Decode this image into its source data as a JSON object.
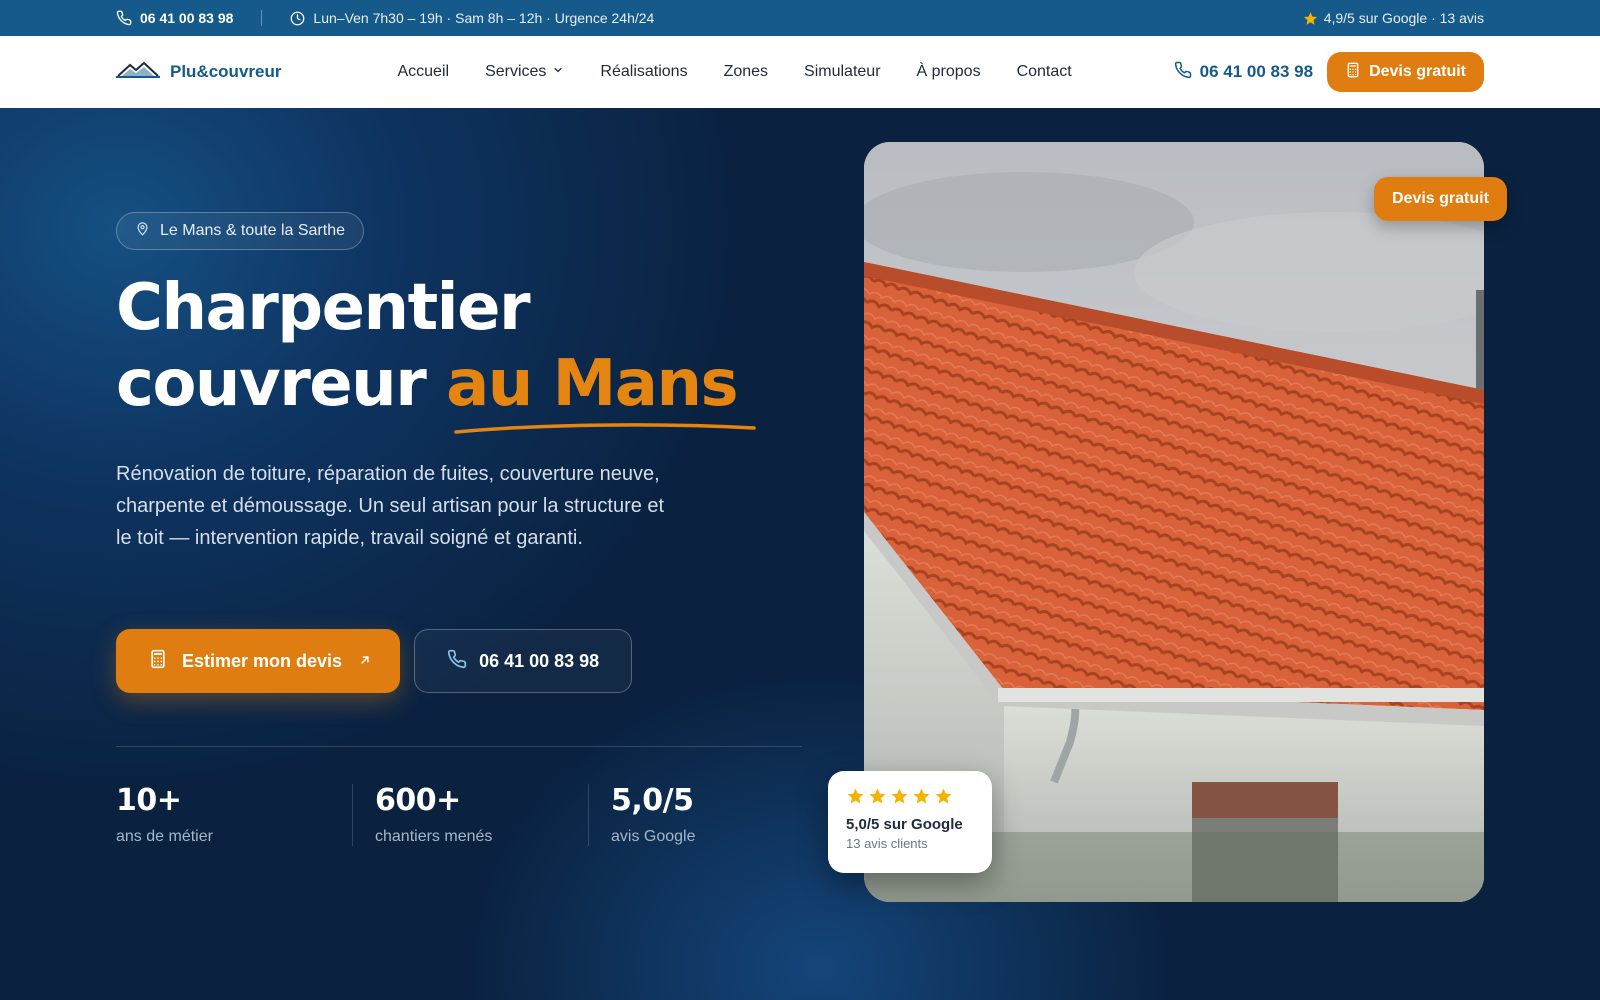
{
  "colors": {
    "accent": "#e07d10",
    "brand": "#155a8a",
    "hero_bg": "#0a2240",
    "star": "#f5b301"
  },
  "topbar": {
    "phone": "06 41 00 83 98",
    "hours": "Lun–Ven 7h30 – 19h · Sam 8h – 12h · Urgence 24h/24",
    "rating": "4,9/5 sur Google · 13 avis"
  },
  "nav": {
    "logo": "Plu&couvreur",
    "items": [
      "Accueil",
      "Services",
      "Réalisations",
      "Zones",
      "Simulateur",
      "À propos",
      "Contact"
    ],
    "phone": "06 41 00 83 98",
    "cta": "Devis gratuit"
  },
  "hero": {
    "location": "Le Mans & toute la Sarthe",
    "title_line1": "Charpentier",
    "title_line2_start": "couvreur ",
    "title_accent": "au Mans",
    "lead": "Rénovation de toiture, réparation de fuites, couverture neuve, charpente et démoussage. Un seul artisan pour la structure et le toit — intervention rapide, travail soigné et garanti.",
    "cta_primary": "Estimer mon devis",
    "cta_phone": "06 41 00 83 98",
    "stats": [
      {
        "value": "10+",
        "label": "ans de métier"
      },
      {
        "value": "600+",
        "label": "chantiers menés"
      },
      {
        "value": "5,0/5",
        "label": "avis Google"
      }
    ],
    "photo_badge": "Devis gratuit",
    "review": {
      "stars": 5,
      "title": "5,0/5 sur Google",
      "subtitle": "13 avis clients"
    }
  },
  "icons": [
    "phone-icon",
    "clock-icon",
    "star-icon",
    "chevron-down-icon",
    "calculator-icon",
    "map-pin-icon",
    "arrow-up-right-icon"
  ]
}
